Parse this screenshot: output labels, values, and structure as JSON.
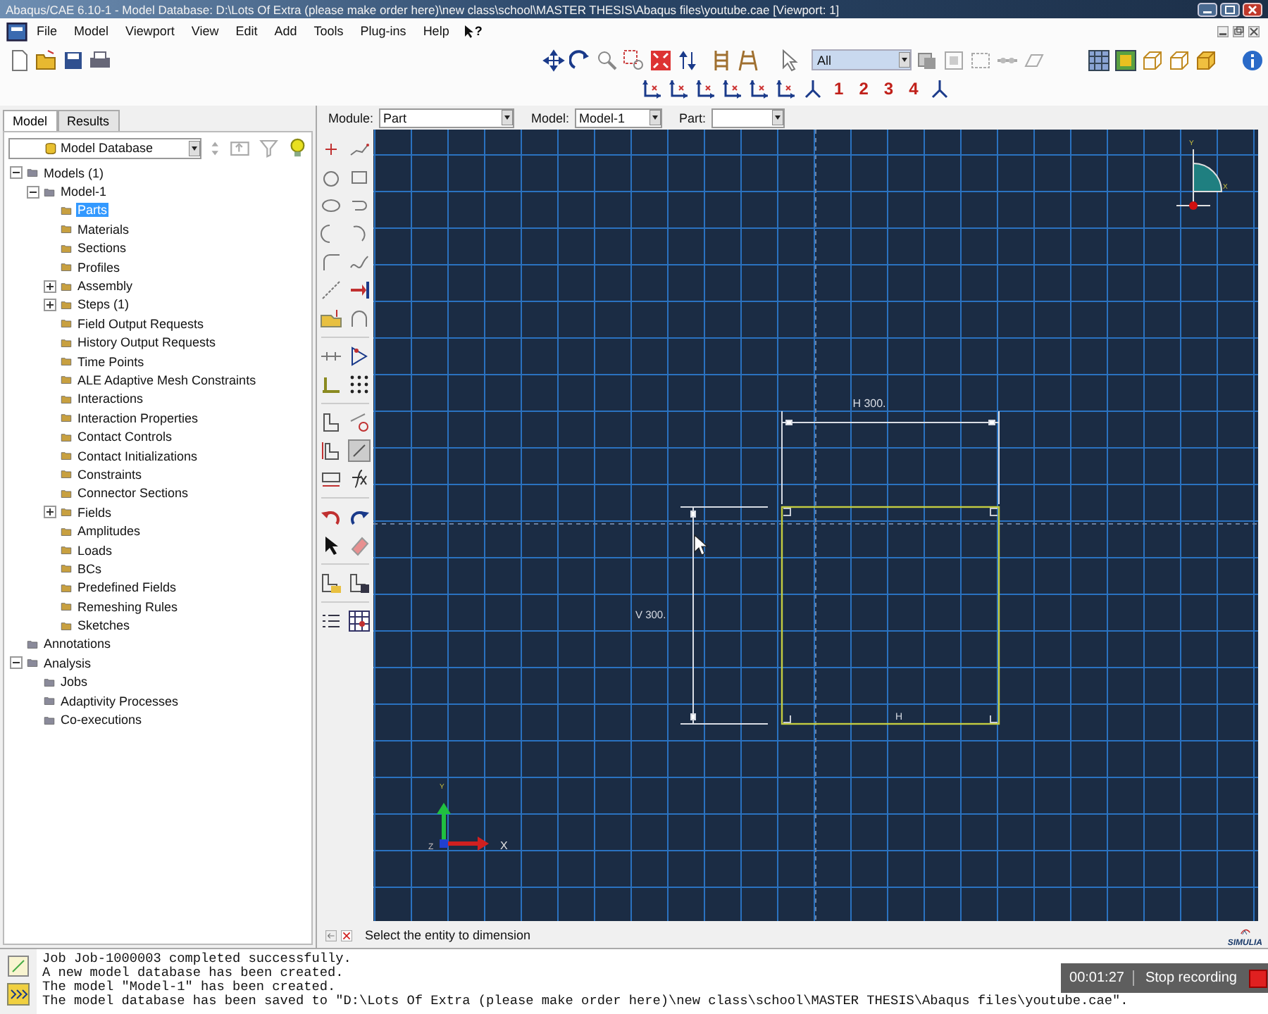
{
  "window": {
    "title": "Abaqus/CAE 6.10-1 - Model Database: D:\\Lots Of Extra (please make order here)\\new class\\school\\MASTER THESIS\\Abaqus files\\youtube.cae [Viewport: 1]"
  },
  "menu": [
    "File",
    "Model",
    "Viewport",
    "View",
    "Edit",
    "Add",
    "Tools",
    "Plug-ins",
    "Help"
  ],
  "context_help": "?",
  "toolbar": {
    "selection_filter": "All",
    "view_buttons": [
      "1",
      "2",
      "3",
      "4"
    ]
  },
  "context_bar": [
    {
      "label": "Module:",
      "value": "Part"
    },
    {
      "label": "Model:",
      "value": "Model-1"
    },
    {
      "label": "Part:"
    }
  ],
  "tabs": [
    {
      "label": "Model",
      "selected": true
    },
    {
      "label": "Results",
      "selected": false
    }
  ],
  "tree": {
    "selector": "Model Database",
    "items": [
      {
        "label": "Models (1)",
        "expanded": true,
        "selected": false,
        "children": [
          {
            "label": "Model-1",
            "expanded": true,
            "selected": false,
            "children": [
              {
                "label": "Parts",
                "selected": true
              },
              {
                "label": "Materials",
                "selected": false
              },
              {
                "label": "Sections",
                "selected": false
              },
              {
                "label": "Profiles",
                "selected": false
              },
              {
                "label": "Assembly",
                "expanded": false,
                "selected": false
              },
              {
                "label": "Steps (1)",
                "expanded": false,
                "selected": false
              },
              {
                "label": "Field Output Requests",
                "selected": false
              },
              {
                "label": "History Output Requests",
                "selected": false
              },
              {
                "label": "Time Points",
                "selected": false
              },
              {
                "label": "ALE Adaptive Mesh Constraints",
                "selected": false
              },
              {
                "label": "Interactions",
                "selected": false
              },
              {
                "label": "Interaction Properties",
                "selected": false
              },
              {
                "label": "Contact Controls",
                "selected": false
              },
              {
                "label": "Contact Initializations",
                "selected": false
              },
              {
                "label": "Constraints",
                "selected": false
              },
              {
                "label": "Connector Sections",
                "selected": false
              },
              {
                "label": "Fields",
                "expanded": false,
                "selected": false
              },
              {
                "label": "Amplitudes",
                "selected": false
              },
              {
                "label": "Loads",
                "selected": false
              },
              {
                "label": "BCs",
                "selected": false
              },
              {
                "label": "Predefined Fields",
                "selected": false
              },
              {
                "label": "Remeshing Rules",
                "selected": false
              },
              {
                "label": "Sketches",
                "selected": false
              }
            ]
          }
        ]
      },
      {
        "label": "Annotations",
        "selected": false
      },
      {
        "label": "Analysis",
        "expanded": true,
        "selected": false,
        "children": [
          {
            "label": "Jobs",
            "selected": false
          },
          {
            "label": "Adaptivity Processes",
            "selected": false
          },
          {
            "label": "Co-executions",
            "selected": false
          }
        ]
      }
    ]
  },
  "sketch": {
    "horizontal_dimension": "H 300.",
    "vertical_dimension": "V 300.",
    "constraint_mark": "H",
    "view_axes": [
      "Y",
      "X"
    ],
    "origin_axes": [
      "Y",
      "Z",
      "X"
    ]
  },
  "prompt": "Select the entity to dimension",
  "logo": "SIMULIA",
  "messages": [
    "Job Job-1000003 completed successfully.",
    "A new model database has been created.",
    "The model \"Model-1\" has been created.",
    "The model database has been saved to \"D:\\Lots Of Extra (please make order here)\\new class\\school\\MASTER THESIS\\Abaqus files\\youtube.cae\"."
  ],
  "recording": {
    "time": "00:01:27",
    "action": "Stop recording"
  }
}
